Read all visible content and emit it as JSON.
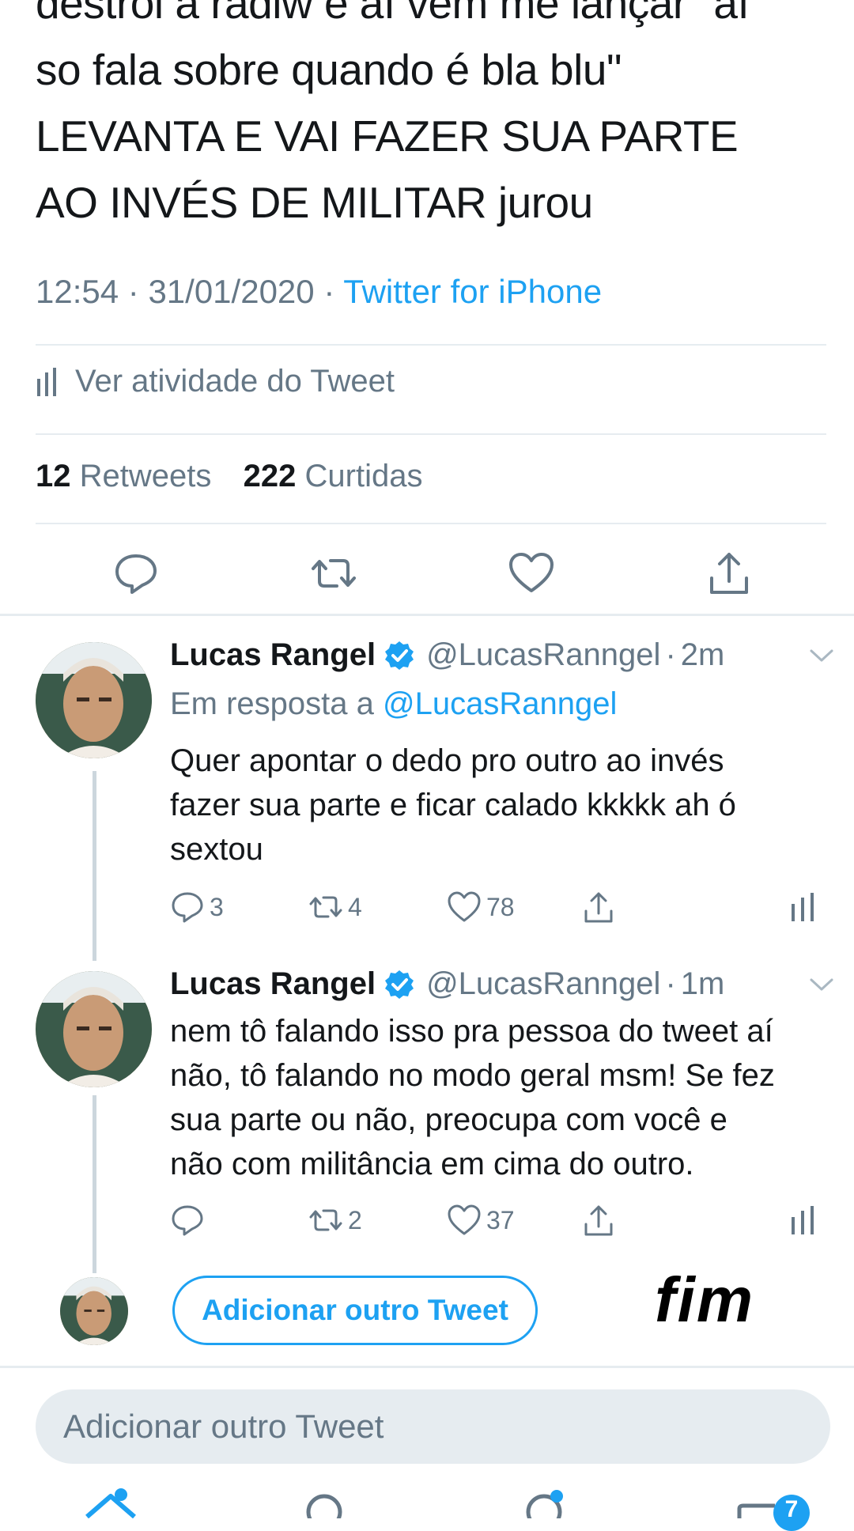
{
  "main_tweet": {
    "text_lines": [
      "destrói a radiw e aí vem me lançar \"aí",
      "so fala sobre quando é bla blu\"",
      "LEVANTA E VAI FAZER SUA PARTE",
      "AO INVÉS DE MILITAR jurou"
    ],
    "time": "12:54",
    "date": "31/01/2020",
    "source": "Twitter for iPhone",
    "activity_label": "Ver atividade do Tweet",
    "retweets_count": "12",
    "retweets_label": "Retweets",
    "likes_count": "222",
    "likes_label": "Curtidas"
  },
  "replies": [
    {
      "name": "Lucas Rangel",
      "handle": "@LucasRanngel",
      "time": "2m",
      "in_reply_prefix": "Em resposta a",
      "in_reply_handle": "@LucasRanngel",
      "text_lines": [
        "Quer apontar o dedo pro outro ao invés",
        "fazer sua parte e ficar calado kkkkk ah ó",
        "sextou"
      ],
      "replies": "3",
      "retweets": "4",
      "likes": "78"
    },
    {
      "name": "Lucas Rangel",
      "handle": "@LucasRanngel",
      "time": "1m",
      "text_lines": [
        "nem tô falando isso pra pessoa do tweet aí",
        "não, tô falando no modo geral msm! Se fez",
        "sua parte ou não, preocupa com você e",
        "não com militância em cima do outro."
      ],
      "replies": "",
      "retweets": "2",
      "likes": "37"
    }
  ],
  "add_tweet_button": "Adicionar outro Tweet",
  "overlay_text": "fim",
  "compose_placeholder": "Adicionar outro Tweet",
  "notification_badge": "7",
  "colors": {
    "accent": "#1da1f2",
    "secondary_text": "#657786",
    "divider": "#e6ecf0"
  }
}
